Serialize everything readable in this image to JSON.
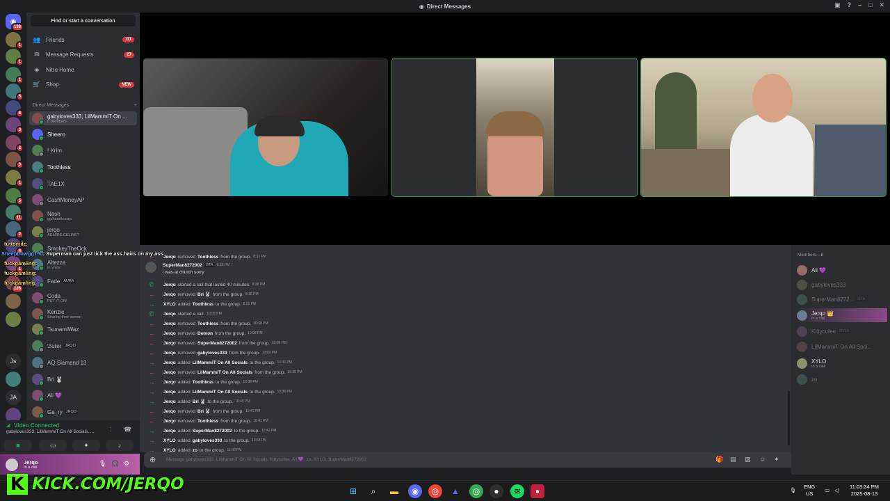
{
  "window": {
    "title": "Direct Messages"
  },
  "rail": {
    "home_badge": "138",
    "badges": [
      "1",
      "1",
      "1",
      "5",
      "8",
      "3",
      "2",
      "3",
      "1",
      "5",
      "11",
      "2",
      "4",
      "1",
      "126"
    ],
    "text_servers": [
      "Js",
      "JA"
    ]
  },
  "sidebar": {
    "search_placeholder": "Find or start a conversation",
    "nav": [
      {
        "icon": "friends-icon",
        "label": "Friends",
        "count": "111"
      },
      {
        "icon": "message-requests-icon",
        "label": "Message Requests",
        "count": "27"
      },
      {
        "icon": "nitro-icon",
        "label": "Nitro Home",
        "count": ""
      },
      {
        "icon": "shop-icon",
        "label": "Shop",
        "count": "NEW"
      }
    ],
    "dm_header": "Direct Messages",
    "dm_add": "+",
    "dms": [
      {
        "name": "gabyloves333, LilMammiT On ...",
        "sub": "8 Members",
        "tag": ""
      },
      {
        "name": "Sheero",
        "sub": "",
        "tag": ""
      },
      {
        "name": "! Xrim",
        "sub": "",
        "tag": ""
      },
      {
        "name": "Toothless",
        "sub": "",
        "tag": ""
      },
      {
        "name": "TAE1X",
        "sub": "",
        "tag": ""
      },
      {
        "name": "CashMoneyAP",
        "sub": "",
        "tag": ""
      },
      {
        "name": "Nash",
        "sub": "gg/heartlessrp",
        "tag": ""
      },
      {
        "name": "jerqo",
        "sub": "ADMIRE CELINE?",
        "tag": ""
      },
      {
        "name": "SmokeyTheOck",
        "sub": "",
        "tag": ""
      },
      {
        "name": "Altezza",
        "sub": "In voice",
        "tag": ""
      },
      {
        "name": "Fade",
        "sub": "",
        "tag": "AURA"
      },
      {
        "name": "Coda",
        "sub": "PUT IT ON!",
        "tag": ""
      },
      {
        "name": "Kenzie",
        "sub": "Sharing their screen",
        "tag": ""
      },
      {
        "name": "TsunamiWaz",
        "sub": "",
        "tag": ""
      },
      {
        "name": "ℬuℓer",
        "sub": "",
        "tag": "JRQO"
      },
      {
        "name": "AQ Siamand 13",
        "sub": "",
        "tag": ""
      },
      {
        "name": "Bri 🐰",
        "sub": "",
        "tag": ""
      },
      {
        "name": "Ali 💜",
        "sub": "",
        "tag": ""
      },
      {
        "name": "Ga_ry",
        "sub": "",
        "tag": "JRQO"
      }
    ]
  },
  "chat_overlay": [
    {
      "user": "tuttomilz",
      "text": "",
      "color": "#ffd54a"
    },
    {
      "user": "SheepDawgg150",
      "text": "Superman can just lick the ass hairs on my ass",
      "color": "#4aa3ff"
    },
    {
      "user": "fuckgamling",
      "text": "",
      "color": "#ffd54a"
    },
    {
      "user": "fuckgamling",
      "text": "",
      "color": "#ffd54a"
    },
    {
      "user": "fuckgamling",
      "text": "",
      "color": "#ffd54a"
    }
  ],
  "voice": {
    "status": "Video Connected",
    "channel": "gabyloves333, LilMammiT On All Socials, ..."
  },
  "user": {
    "name": "Jerqo",
    "status": "In a call"
  },
  "stream_overlay": {
    "text": "KICK.COM/JERQO",
    "logo": "K"
  },
  "messages": [
    {
      "dir": "out",
      "actor": "Jerqo",
      "action": "removed",
      "target": "Toothless",
      "suffix": "from the group.",
      "time": "8:33 PM"
    },
    {
      "dir": "user",
      "actor": "SuperMan8272002",
      "tag": "GTA",
      "time": "8:33 PM",
      "text": "i was at church sorry"
    },
    {
      "dir": "call",
      "actor": "Jerqo",
      "action": "started a call that lasted 40 minutes.",
      "target": "",
      "suffix": "",
      "time": "8:38 PM"
    },
    {
      "dir": "out",
      "actor": "Jerqo",
      "action": "removed",
      "target": "Bri 🐰",
      "suffix": "from the group.",
      "time": "8:38 PM"
    },
    {
      "dir": "in",
      "actor": "XYLO",
      "action": "added",
      "target": "Toothless",
      "suffix": "to the group.",
      "time": "8:55 PM"
    },
    {
      "dir": "call",
      "actor": "Jerqo",
      "action": "started a call.",
      "target": "",
      "suffix": "",
      "time": "10:08 PM"
    },
    {
      "dir": "out",
      "actor": "Jerqo",
      "action": "removed",
      "target": "Toothless",
      "suffix": "from the group.",
      "time": "10:08 PM"
    },
    {
      "dir": "out",
      "actor": "Jerqo",
      "action": "removed",
      "target": "Demon",
      "suffix": "from the group.",
      "time": "10:08 PM"
    },
    {
      "dir": "out",
      "actor": "Jerqo",
      "action": "removed",
      "target": "SuperMan8272002",
      "suffix": "from the group.",
      "time": "10:09 PM"
    },
    {
      "dir": "out",
      "actor": "Jerqo",
      "action": "removed",
      "target": "gabyloves333",
      "suffix": "from the group.",
      "time": "10:09 PM"
    },
    {
      "dir": "in",
      "actor": "Jerqo",
      "action": "added",
      "target": "LilMammiT On All Socials",
      "suffix": "to the group.",
      "time": "10:33 PM"
    },
    {
      "dir": "out",
      "actor": "Jerqo",
      "action": "removed",
      "target": "LilMammiT On All Socials",
      "suffix": "from the group.",
      "time": "10:35 PM"
    },
    {
      "dir": "in",
      "actor": "Jerqo",
      "action": "added",
      "target": "Toothless",
      "suffix": "to the group.",
      "time": "10:36 PM"
    },
    {
      "dir": "in",
      "actor": "Jerqo",
      "action": "added",
      "target": "LilMammiT On All Socials",
      "suffix": "to the group.",
      "time": "10:38 PM"
    },
    {
      "dir": "in",
      "actor": "Jerqo",
      "action": "added",
      "target": "Bri 🐰",
      "suffix": "to the group.",
      "time": "10:40 PM"
    },
    {
      "dir": "out",
      "actor": "Jerqo",
      "action": "removed",
      "target": "Bri 🐰",
      "suffix": "from the group.",
      "time": "10:41 PM"
    },
    {
      "dir": "out",
      "actor": "Jerqo",
      "action": "removed",
      "target": "Toothless",
      "suffix": "from the group.",
      "time": "10:41 PM"
    },
    {
      "dir": "in",
      "actor": "Jerqo",
      "action": "added",
      "target": "SuperMan8272002",
      "suffix": "to the group.",
      "time": "10:42 PM"
    },
    {
      "dir": "in",
      "actor": "XYLO",
      "action": "added",
      "target": "gabyloves333",
      "suffix": "to the group.",
      "time": "10:58 PM"
    },
    {
      "dir": "in",
      "actor": "XYLO",
      "action": "added",
      "target": "zo",
      "suffix": "to the group.",
      "time": "11:00 PM"
    }
  ],
  "composer": {
    "placeholder": "Message gabyloves333, LilMammiT On All Socials, Kittycofee, Ali 💜, zo, XYLO, SuperMan8272002"
  },
  "members": {
    "header": "Members—8",
    "list": [
      {
        "name": "Ali 💜",
        "sub": "",
        "tag": "",
        "dim": false
      },
      {
        "name": "gabyloves333",
        "sub": "",
        "tag": "",
        "dim": true
      },
      {
        "name": "SuperMan8272...",
        "sub": "",
        "tag": "GTA",
        "dim": true
      },
      {
        "name": "Jerqo 👑",
        "sub": "In a call",
        "tag": "",
        "dim": false
      },
      {
        "name": "Kittycofee",
        "sub": "",
        "tag": "RVLS",
        "dim": true
      },
      {
        "name": "LilMammiT On All Soci...",
        "sub": "",
        "tag": "",
        "dim": true
      },
      {
        "name": "XYLO",
        "sub": "In a call",
        "tag": "",
        "dim": false
      },
      {
        "name": "zo",
        "sub": "",
        "tag": "",
        "dim": true
      }
    ]
  },
  "taskbar": {
    "lang1": "ENG",
    "lang2": "US",
    "time": "11:03:34 PM",
    "date": "2025-08-13"
  }
}
